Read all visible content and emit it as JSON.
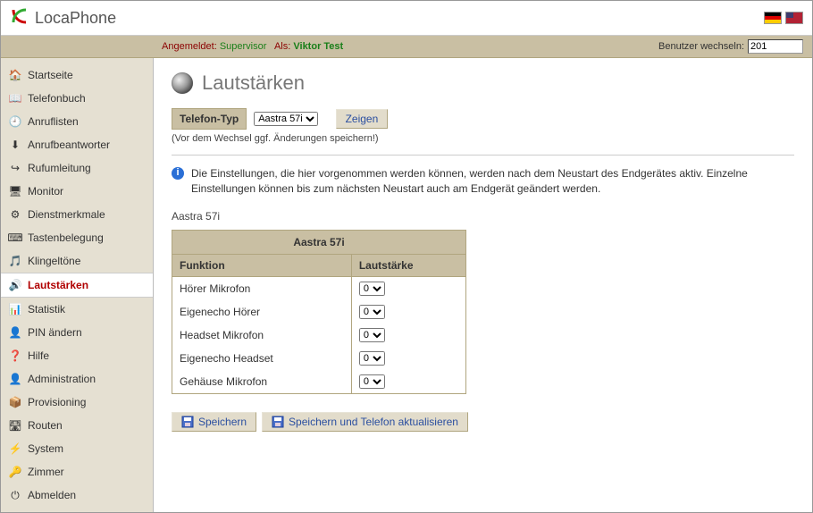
{
  "brand": "LocaPhone",
  "lang": {
    "de": "Deutsch",
    "us": "English (US)"
  },
  "status": {
    "logged_in_label": "Angemeldet:",
    "logged_in_user": "Supervisor",
    "as_label": "Als:",
    "as_user": "Viktor Test",
    "switch_label": "Benutzer wechseln:",
    "switch_value": "201"
  },
  "sidebar": {
    "items": [
      {
        "label": "Startseite",
        "icon": "🏠"
      },
      {
        "label": "Telefonbuch",
        "icon": "📖"
      },
      {
        "label": "Anruflisten",
        "icon": "🕘"
      },
      {
        "label": "Anrufbeantworter",
        "icon": "⬇"
      },
      {
        "label": "Rufumleitung",
        "icon": "↪"
      },
      {
        "label": "Monitor",
        "icon": "🖥"
      },
      {
        "label": "Dienstmerkmale",
        "icon": "⚙"
      },
      {
        "label": "Tastenbelegung",
        "icon": "⌨"
      },
      {
        "label": "Klingeltöne",
        "icon": "🎵"
      },
      {
        "label": "Lautstärken",
        "icon": "🔊",
        "active": true
      },
      {
        "label": "Statistik",
        "icon": "📊"
      },
      {
        "label": "PIN ändern",
        "icon": "👤"
      },
      {
        "label": "Hilfe",
        "icon": "❓"
      },
      {
        "label": "Administration",
        "icon": "👤"
      },
      {
        "label": "Provisioning",
        "icon": "📦"
      },
      {
        "label": "Routen",
        "icon": "🛣"
      },
      {
        "label": "System",
        "icon": "⚡"
      },
      {
        "label": "Zimmer",
        "icon": "🔑"
      },
      {
        "label": "Abmelden",
        "icon": "⏻"
      }
    ]
  },
  "page": {
    "title": "Lautstärken",
    "type_label": "Telefon-Typ",
    "type_selected": "Aastra 57i",
    "show_btn": "Zeigen",
    "hint": "(Vor dem Wechsel ggf. Änderungen speichern!)",
    "info": "Die Einstellungen, die hier vorgenommen werden können, werden nach dem Neustart des Endgerätes aktiv. Einzelne Einstellungen können bis zum nächsten Neustart auch am Endgerät geändert werden.",
    "device_section_label": "Aastra 57i",
    "table": {
      "caption": "Aastra 57i",
      "col_function": "Funktion",
      "col_volume": "Lautstärke",
      "rows": [
        {
          "fn": "Hörer Mikrofon",
          "val": "0"
        },
        {
          "fn": "Eigenecho Hörer",
          "val": "0"
        },
        {
          "fn": "Headset Mikrofon",
          "val": "0"
        },
        {
          "fn": "Eigenecho Headset",
          "val": "0"
        },
        {
          "fn": "Gehäuse Mikrofon",
          "val": "0"
        }
      ]
    },
    "actions": {
      "save": "Speichern",
      "save_update": "Speichern und Telefon aktualisieren"
    }
  }
}
